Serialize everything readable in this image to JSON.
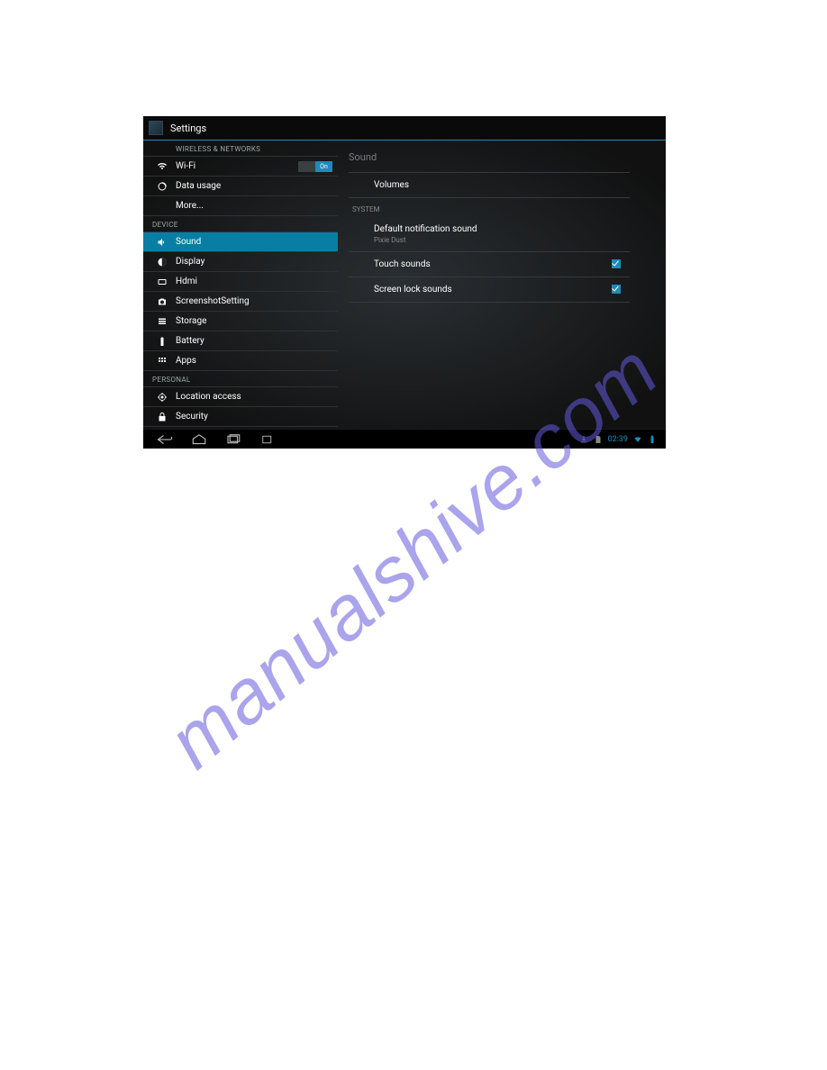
{
  "watermark": "manualshive.com",
  "header": {
    "title": "Settings"
  },
  "sidebar": {
    "section_wireless": "WIRELESS & NETWORKS",
    "section_device": "DEVICE",
    "section_personal": "PERSONAL",
    "items": {
      "wifi": {
        "label": "Wi-Fi",
        "toggle_on": "On"
      },
      "data_usage": {
        "label": "Data usage"
      },
      "more": {
        "label": "More..."
      },
      "sound": {
        "label": "Sound"
      },
      "display": {
        "label": "Display"
      },
      "hdmi": {
        "label": "Hdmi"
      },
      "screenshot": {
        "label": "ScreenshotSetting"
      },
      "storage": {
        "label": "Storage"
      },
      "battery": {
        "label": "Battery"
      },
      "apps": {
        "label": "Apps"
      },
      "location": {
        "label": "Location access"
      },
      "security": {
        "label": "Security"
      }
    }
  },
  "content": {
    "title": "Sound",
    "volumes": "Volumes",
    "system_header": "SYSTEM",
    "default_notification": {
      "label": "Default notification sound",
      "sub": "Pixie Dust"
    },
    "touch_sounds": "Touch sounds",
    "screen_lock_sounds": "Screen lock sounds"
  },
  "statusbar": {
    "time": "02:39"
  }
}
